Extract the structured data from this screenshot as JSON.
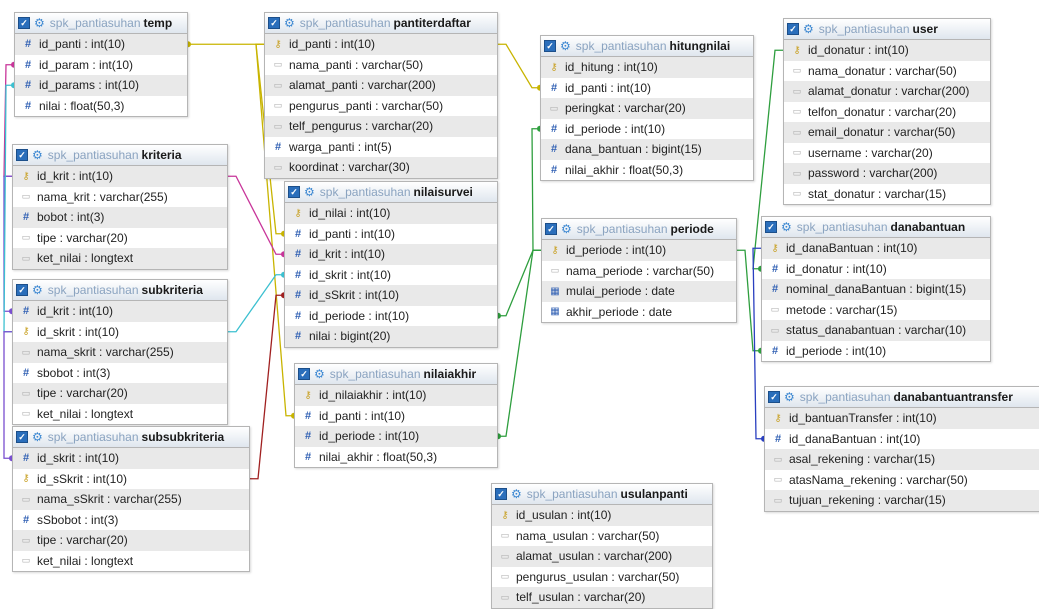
{
  "schema": "spk_pantiasuhan",
  "tables": [
    {
      "id": "temp",
      "name": "temp",
      "columns": [
        {
          "label": "id_panti : int(10)",
          "icon": "number-icon"
        },
        {
          "label": "id_param : int(10)",
          "icon": "number-icon"
        },
        {
          "label": "id_params : int(10)",
          "icon": "number-icon"
        },
        {
          "label": "nilai : float(50,3)",
          "icon": "number-icon"
        }
      ]
    },
    {
      "id": "pantiterdaftar",
      "name": "pantiterdaftar",
      "columns": [
        {
          "label": "id_panti : int(10)",
          "icon": "key-icon"
        },
        {
          "label": "nama_panti : varchar(50)",
          "icon": "text-icon"
        },
        {
          "label": "alamat_panti : varchar(200)",
          "icon": "text-icon"
        },
        {
          "label": "pengurus_panti : varchar(50)",
          "icon": "text-icon"
        },
        {
          "label": "telf_pengurus : varchar(20)",
          "icon": "text-icon"
        },
        {
          "label": "warga_panti : int(5)",
          "icon": "number-icon"
        },
        {
          "label": "koordinat : varchar(30)",
          "icon": "text-icon"
        }
      ]
    },
    {
      "id": "hitungnilai",
      "name": "hitungnilai",
      "columns": [
        {
          "label": "id_hitung : int(10)",
          "icon": "key-icon"
        },
        {
          "label": "id_panti : int(10)",
          "icon": "number-icon"
        },
        {
          "label": "peringkat : varchar(20)",
          "icon": "text-icon"
        },
        {
          "label": "id_periode : int(10)",
          "icon": "number-icon"
        },
        {
          "label": "dana_bantuan : bigint(15)",
          "icon": "number-icon"
        },
        {
          "label": "nilai_akhir : float(50,3)",
          "icon": "number-icon"
        }
      ]
    },
    {
      "id": "user",
      "name": "user",
      "columns": [
        {
          "label": "id_donatur : int(10)",
          "icon": "key-icon"
        },
        {
          "label": "nama_donatur : varchar(50)",
          "icon": "text-icon"
        },
        {
          "label": "alamat_donatur : varchar(200)",
          "icon": "text-icon"
        },
        {
          "label": "telfon_donatur : varchar(20)",
          "icon": "text-icon"
        },
        {
          "label": "email_donatur : varchar(50)",
          "icon": "text-icon"
        },
        {
          "label": "username : varchar(20)",
          "icon": "text-icon"
        },
        {
          "label": "password : varchar(200)",
          "icon": "text-icon"
        },
        {
          "label": "stat_donatur : varchar(15)",
          "icon": "text-icon"
        }
      ]
    },
    {
      "id": "kriteria",
      "name": "kriteria",
      "columns": [
        {
          "label": "id_krit : int(10)",
          "icon": "key-icon"
        },
        {
          "label": "nama_krit : varchar(255)",
          "icon": "text-icon"
        },
        {
          "label": "bobot : int(3)",
          "icon": "number-icon"
        },
        {
          "label": "tipe : varchar(20)",
          "icon": "text-icon"
        },
        {
          "label": "ket_nilai : longtext",
          "icon": "text-icon"
        }
      ]
    },
    {
      "id": "nilaisurvei",
      "name": "nilaisurvei",
      "columns": [
        {
          "label": "id_nilai : int(10)",
          "icon": "key-icon"
        },
        {
          "label": "id_panti : int(10)",
          "icon": "number-icon"
        },
        {
          "label": "id_krit : int(10)",
          "icon": "number-icon"
        },
        {
          "label": "id_skrit : int(10)",
          "icon": "number-icon"
        },
        {
          "label": "id_sSkrit : int(10)",
          "icon": "number-icon"
        },
        {
          "label": "id_periode : int(10)",
          "icon": "number-icon"
        },
        {
          "label": "nilai : bigint(20)",
          "icon": "number-icon"
        }
      ]
    },
    {
      "id": "periode",
      "name": "periode",
      "columns": [
        {
          "label": "id_periode : int(10)",
          "icon": "key-icon"
        },
        {
          "label": "nama_periode : varchar(50)",
          "icon": "text-icon"
        },
        {
          "label": "mulai_periode : date",
          "icon": "calendar-icon"
        },
        {
          "label": "akhir_periode : date",
          "icon": "calendar-icon"
        }
      ]
    },
    {
      "id": "danabantuan",
      "name": "danabantuan",
      "columns": [
        {
          "label": "id_danaBantuan : int(10)",
          "icon": "key-icon"
        },
        {
          "label": "id_donatur : int(10)",
          "icon": "number-icon"
        },
        {
          "label": "nominal_danaBantuan : bigint(15)",
          "icon": "number-icon"
        },
        {
          "label": "metode : varchar(15)",
          "icon": "text-icon"
        },
        {
          "label": "status_danabantuan : varchar(10)",
          "icon": "text-icon"
        },
        {
          "label": "id_periode : int(10)",
          "icon": "number-icon"
        }
      ]
    },
    {
      "id": "subkriteria",
      "name": "subkriteria",
      "columns": [
        {
          "label": "id_krit : int(10)",
          "icon": "number-icon"
        },
        {
          "label": "id_skrit : int(10)",
          "icon": "key-icon"
        },
        {
          "label": "nama_skrit : varchar(255)",
          "icon": "text-icon"
        },
        {
          "label": "sbobot : int(3)",
          "icon": "number-icon"
        },
        {
          "label": "tipe : varchar(20)",
          "icon": "text-icon"
        },
        {
          "label": "ket_nilai : longtext",
          "icon": "text-icon"
        }
      ]
    },
    {
      "id": "nilaiakhir",
      "name": "nilaiakhir",
      "columns": [
        {
          "label": "id_nilaiakhir : int(10)",
          "icon": "key-icon"
        },
        {
          "label": "id_panti : int(10)",
          "icon": "number-icon"
        },
        {
          "label": "id_periode : int(10)",
          "icon": "number-icon"
        },
        {
          "label": "nilai_akhir : float(50,3)",
          "icon": "number-icon"
        }
      ]
    },
    {
      "id": "danabantuantransfer",
      "name": "danabantuantransfer",
      "columns": [
        {
          "label": "id_bantuanTransfer : int(10)",
          "icon": "key-icon"
        },
        {
          "label": "id_danaBantuan : int(10)",
          "icon": "number-icon"
        },
        {
          "label": "asal_rekening : varchar(15)",
          "icon": "text-icon"
        },
        {
          "label": "atasNama_rekening : varchar(50)",
          "icon": "text-icon"
        },
        {
          "label": "tujuan_rekening : varchar(15)",
          "icon": "text-icon"
        }
      ]
    },
    {
      "id": "subsubkriteria",
      "name": "subsubkriteria",
      "columns": [
        {
          "label": "id_skrit : int(10)",
          "icon": "number-icon"
        },
        {
          "label": "id_sSkrit : int(10)",
          "icon": "key-icon"
        },
        {
          "label": "nama_sSkrit : varchar(255)",
          "icon": "text-icon"
        },
        {
          "label": "sSbobot : int(3)",
          "icon": "number-icon"
        },
        {
          "label": "tipe : varchar(20)",
          "icon": "text-icon"
        },
        {
          "label": "ket_nilai : longtext",
          "icon": "text-icon"
        }
      ]
    },
    {
      "id": "usulanpanti",
      "name": "usulanpanti",
      "columns": [
        {
          "label": "id_usulan : int(10)",
          "icon": "key-icon"
        },
        {
          "label": "nama_usulan : varchar(50)",
          "icon": "text-icon"
        },
        {
          "label": "alamat_usulan : varchar(200)",
          "icon": "text-icon"
        },
        {
          "label": "pengurus_usulan : varchar(50)",
          "icon": "text-icon"
        },
        {
          "label": "telf_usulan : varchar(20)",
          "icon": "text-icon"
        }
      ]
    }
  ],
  "relations": [
    {
      "from": "temp",
      "from_col": 0,
      "to": "pantiterdaftar",
      "to_col": 0,
      "color": "#c8b400"
    },
    {
      "from": "hitungnilai",
      "from_col": 1,
      "to": "pantiterdaftar",
      "to_col": 0,
      "color": "#c8b400"
    },
    {
      "from": "nilaisurvei",
      "from_col": 1,
      "to": "pantiterdaftar",
      "to_col": 0,
      "color": "#c8b400"
    },
    {
      "from": "nilaiakhir",
      "from_col": 1,
      "to": "pantiterdaftar",
      "to_col": 0,
      "color": "#c8b400"
    },
    {
      "from": "nilaisurvei",
      "from_col": 2,
      "to": "kriteria",
      "to_col": 0,
      "color": "#c8359a"
    },
    {
      "from": "temp",
      "from_col": 1,
      "to": "kriteria",
      "to_col": 0,
      "color": "#c8359a"
    },
    {
      "from": "subkriteria",
      "from_col": 0,
      "to": "kriteria",
      "to_col": 0,
      "color": "#7a4fd0"
    },
    {
      "from": "nilaisurvei",
      "from_col": 3,
      "to": "subkriteria",
      "to_col": 1,
      "color": "#3cc0d0"
    },
    {
      "from": "temp",
      "from_col": 2,
      "to": "subkriteria",
      "to_col": 1,
      "color": "#3cc0d0"
    },
    {
      "from": "subsubkriteria",
      "from_col": 0,
      "to": "subkriteria",
      "to_col": 1,
      "color": "#7a4fd0"
    },
    {
      "from": "nilaisurvei",
      "from_col": 4,
      "to": "subsubkriteria",
      "to_col": 1,
      "color": "#a02020"
    },
    {
      "from": "hitungnilai",
      "from_col": 3,
      "to": "periode",
      "to_col": 0,
      "color": "#2e9e3e"
    },
    {
      "from": "nilaisurvei",
      "from_col": 5,
      "to": "periode",
      "to_col": 0,
      "color": "#2e9e3e"
    },
    {
      "from": "nilaiakhir",
      "from_col": 2,
      "to": "periode",
      "to_col": 0,
      "color": "#2e9e3e"
    },
    {
      "from": "danabantuan",
      "from_col": 5,
      "to": "periode",
      "to_col": 0,
      "color": "#2e9e3e"
    },
    {
      "from": "danabantuan",
      "from_col": 1,
      "to": "user",
      "to_col": 0,
      "color": "#2e9e3e"
    },
    {
      "from": "danabantuantransfer",
      "from_col": 1,
      "to": "danabantuan",
      "to_col": 0,
      "color": "#2a3fc0"
    }
  ]
}
